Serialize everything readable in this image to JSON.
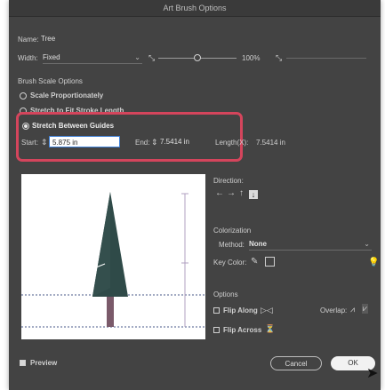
{
  "window": {
    "title": "Art Brush Options"
  },
  "name": {
    "label": "Name:",
    "value": "Tree"
  },
  "width": {
    "label": "Width:",
    "mode": "Fixed",
    "percent": "100%"
  },
  "scale_options": {
    "heading": "Brush Scale Options",
    "scale_proportionately": "Scale Proportionately",
    "stretch_to_fit": "Stretch to Fit Stroke Length",
    "stretch_between_guides": "Stretch Between Guides",
    "start_label": "Start:",
    "start_value": "5.875 in",
    "end_label": "End:",
    "end_value": "7.5414 in",
    "length_label": "Length(X):",
    "length_value": "7.5414 in"
  },
  "direction": {
    "label": "Direction:",
    "arrows": [
      "←",
      "→",
      "↑",
      "↓"
    ],
    "selected": "↓"
  },
  "colorization": {
    "heading": "Colorization",
    "method_label": "Method:",
    "method_value": "None",
    "key_color_label": "Key Color:"
  },
  "options": {
    "heading": "Options",
    "flip_along": "Flip Along",
    "flip_across": "Flip Across",
    "overlap_label": "Overlap:"
  },
  "footer": {
    "preview_label": "Preview",
    "cancel_label": "Cancel",
    "ok_label": "OK"
  },
  "colors": {
    "dialog_bg": "#434343",
    "highlight": "#d4455c",
    "tree": "#2f4a48",
    "trunk": "#7a5a6a"
  }
}
